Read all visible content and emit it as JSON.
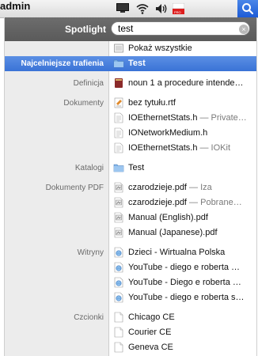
{
  "menubar": {
    "user": "admin"
  },
  "spotlight": {
    "label": "Spotlight",
    "query": "test",
    "clear": "×",
    "show_all": "Pokaż wszystkie"
  },
  "sections": [
    {
      "category": "Najcelniejsze trafienia",
      "selected": true,
      "items": [
        {
          "icon": "folder-icon",
          "text": "Test",
          "sub": ""
        }
      ]
    },
    {
      "category": "Definicja",
      "items": [
        {
          "icon": "dictionary-icon",
          "text": "noun  1 a procedure intende…",
          "sub": ""
        }
      ]
    },
    {
      "category": "Dokumenty",
      "items": [
        {
          "icon": "rtf-document-icon",
          "text": "bez tytułu.rtf",
          "sub": ""
        },
        {
          "icon": "header-file-icon",
          "text": "IOEthernetStats.h",
          "sub": " — Private…"
        },
        {
          "icon": "header-file-icon",
          "text": "IONetworkMedium.h",
          "sub": ""
        },
        {
          "icon": "header-file-icon",
          "text": "IOEthernetStats.h",
          "sub": " — IOKit"
        }
      ]
    },
    {
      "category": "Katalogi",
      "items": [
        {
          "icon": "folder-icon",
          "text": "Test",
          "sub": ""
        }
      ]
    },
    {
      "category": "Dokumenty PDF",
      "items": [
        {
          "icon": "pdf-icon",
          "text": "czarodzieje.pdf",
          "sub": " — Iza"
        },
        {
          "icon": "pdf-icon",
          "text": "czarodzieje.pdf",
          "sub": " — Pobrane…"
        },
        {
          "icon": "pdf-icon",
          "text": "Manual (English).pdf",
          "sub": ""
        },
        {
          "icon": "pdf-icon",
          "text": "Manual (Japanese).pdf",
          "sub": ""
        }
      ]
    },
    {
      "category": "Witryny",
      "items": [
        {
          "icon": "webpage-icon",
          "text": "Dzieci - Wirtualna Polska",
          "sub": ""
        },
        {
          "icon": "webpage-icon",
          "text": "YouTube - diego e roberta …",
          "sub": ""
        },
        {
          "icon": "webpage-icon",
          "text": "YouTube - Diego e roberta …",
          "sub": ""
        },
        {
          "icon": "webpage-icon",
          "text": "YouTube - diego e roberta s…",
          "sub": ""
        }
      ]
    },
    {
      "category": "Czcionki",
      "items": [
        {
          "icon": "font-file-icon",
          "text": "Chicago CE",
          "sub": ""
        },
        {
          "icon": "font-file-icon",
          "text": "Courier CE",
          "sub": ""
        },
        {
          "icon": "font-file-icon",
          "text": "Geneva CE",
          "sub": ""
        }
      ]
    }
  ]
}
